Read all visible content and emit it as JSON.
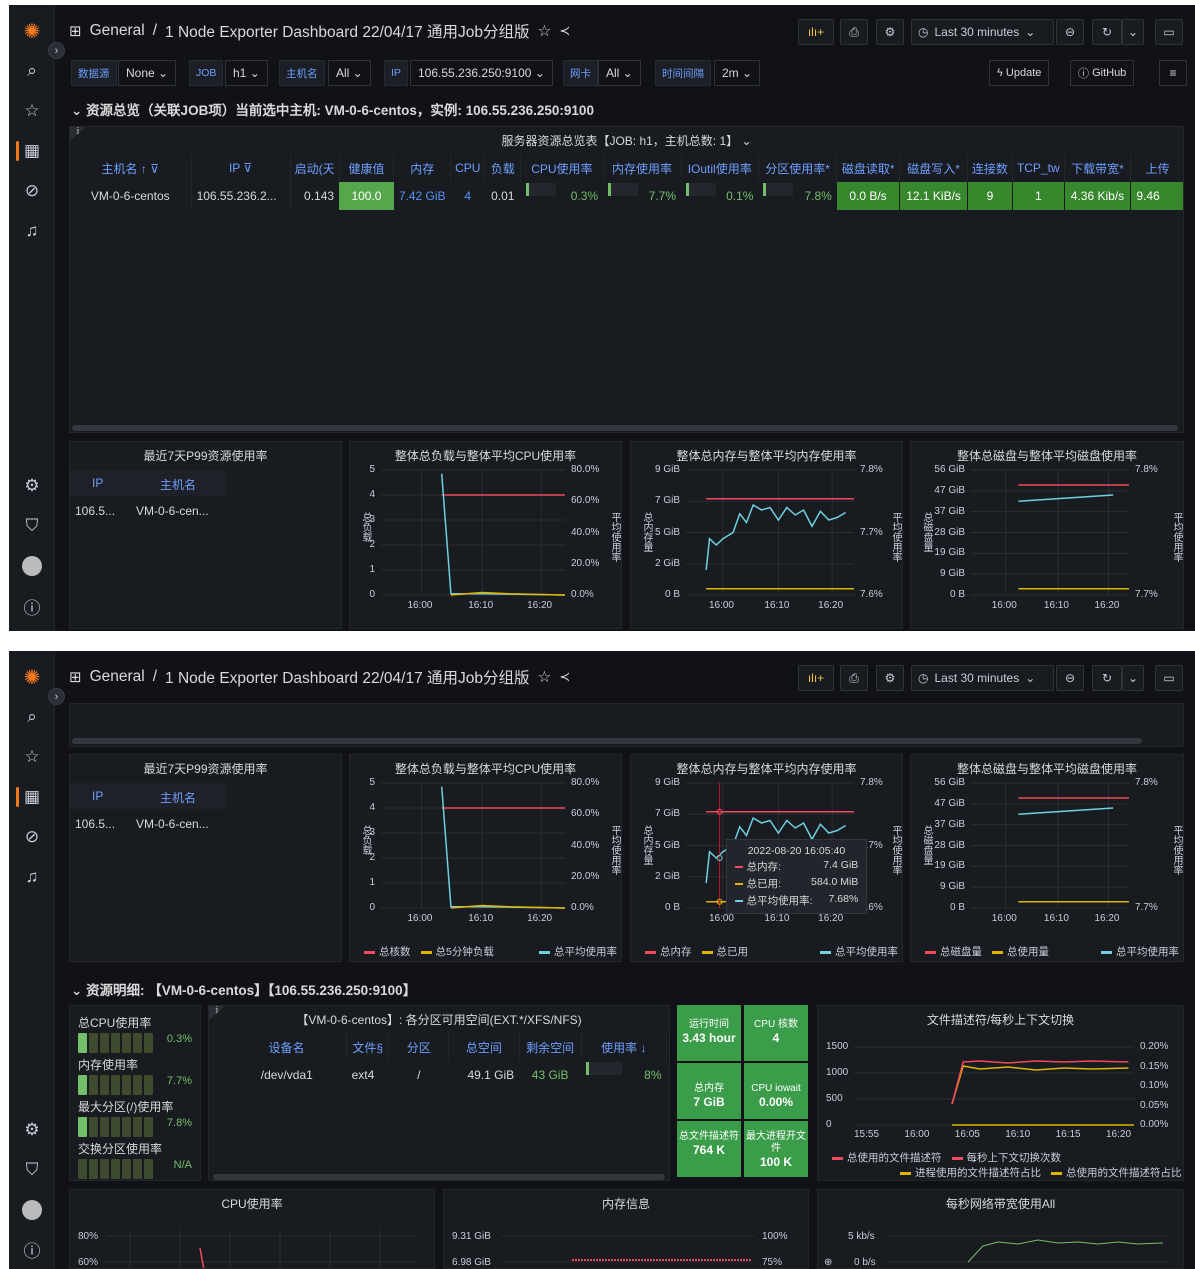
{
  "nav": {
    "home_label": "General",
    "separator": "/",
    "dashboard_title": "1 Node Exporter Dashboard 22/04/17 通用Job分组版",
    "time_range": "Last 30 minutes",
    "grid_icon": "grid-icon",
    "star_icon": "star-icon",
    "share_icon": "share-icon"
  },
  "sidebar": {
    "icons": [
      "grafana-logo-icon",
      "search-icon",
      "star-icon",
      "dashboards-icon",
      "explore-icon",
      "alerting-icon",
      "configuration-icon",
      "shield-icon",
      "user-avatar",
      "help-icon"
    ]
  },
  "variables": [
    {
      "label": "数据源",
      "value": "None"
    },
    {
      "label": "JOB",
      "value": "h1"
    },
    {
      "label": "主机名",
      "value": "All"
    },
    {
      "label": "IP",
      "value": "106.55.236.250:9100"
    },
    {
      "label": "网卡",
      "value": "All"
    },
    {
      "label": "时间间隔",
      "value": "2m"
    }
  ],
  "links": {
    "update": "Update",
    "github": "GitHub"
  },
  "overview": {
    "row_title": "资源总览（关联JOB项）当前选中主机: VM-0-6-centos，实例: 106.55.236.250:9100",
    "table_title": "服务器资源总览表【JOB: h1，主机总数: 1】",
    "columns": [
      "主机名",
      "IP",
      "启动(天",
      "健康值",
      "内存",
      "CPU",
      "负载",
      "CPU使用率",
      "内存使用率",
      "IOutil使用率",
      "分区使用率*",
      "磁盘读取*",
      "磁盘写入*",
      "连接数",
      "TCP_tw",
      "下载带宽*",
      "上传"
    ],
    "row": {
      "host": "VM-0-6-centos",
      "ip": "106.55.236.2...",
      "uptime": "0.143",
      "health": "100.0",
      "mem": "7.42 GiB",
      "cpu": "4",
      "load": "0.01",
      "cpu_pct": "0.3%",
      "mem_pct": "7.7%",
      "io_pct": "0.1%",
      "part_pct": "7.8%",
      "disk_read": "0.0 B/s",
      "disk_write": "12.1 KiB/s",
      "conn": "9",
      "tcp_tw": "1",
      "down": "4.36 Kib/s",
      "up": "9.46"
    },
    "gauges": {
      "cpu": 0.003,
      "mem": 0.077,
      "io": 0.001,
      "part": 0.078
    }
  },
  "p99": {
    "title": "最近7天P99资源使用率",
    "col_ip": "IP",
    "col_host": "主机名",
    "ip": "106.5...",
    "host": "VM-0-6-cen..."
  },
  "charts": {
    "load": {
      "title": "整体总负载与整体平均CPU使用率",
      "ylabel": "总负载",
      "y2label": "平均使用率",
      "yticks": [
        "5",
        "4",
        "3",
        "2",
        "1",
        "0"
      ],
      "y2ticks": [
        "80.0%",
        "60.0%",
        "40.0%",
        "20.0%",
        "0.0%"
      ],
      "xticks": [
        "16:00",
        "16:10",
        "16:20"
      ],
      "legend": [
        "总核数",
        "总5分钟负载",
        "总平均使用率"
      ]
    },
    "mem": {
      "title": "整体总内存与整体平均内存使用率",
      "ylabel": "总内存量",
      "y2label": "平均使用率",
      "yticks": [
        "9 GiB",
        "7 GiB",
        "5 GiB",
        "2 GiB",
        "0 B"
      ],
      "y2ticks": [
        "7.8%",
        "7.7%",
        "7.6%"
      ],
      "xticks": [
        "16:00",
        "16:10",
        "16:20"
      ],
      "legend": [
        "总内存",
        "总已用",
        "总平均使用率"
      ]
    },
    "disk": {
      "title": "整体总磁盘与整体平均磁盘使用率",
      "ylabel": "总磁盘量",
      "y2label": "平均使用率",
      "yticks": [
        "56 GiB",
        "47 GiB",
        "37 GiB",
        "28 GiB",
        "19 GiB",
        "9 GiB",
        "0 B"
      ],
      "y2ticks": [
        "7.8%",
        "7.7%"
      ],
      "xticks": [
        "16:00",
        "16:10",
        "16:20"
      ],
      "legend": [
        "总磁盘量",
        "总使用量",
        "总平均使用率"
      ]
    }
  },
  "tooltip": {
    "time": "2022-08-20 16:05:40",
    "rows": [
      {
        "k": "总内存:",
        "v": "7.4 GiB"
      },
      {
        "k": "总已用:",
        "v": "584.0 MiB"
      },
      {
        "k": "总平均使用率:",
        "v": "7.68%"
      }
    ]
  },
  "detail": {
    "row_title": "资源明细: 【VM-0-6-centos】【106.55.236.250:9100】",
    "bars": [
      {
        "label": "总CPU使用率",
        "value": "0.3%",
        "on": 1
      },
      {
        "label": "内存使用率",
        "value": "7.7%",
        "on": 1
      },
      {
        "label": "最大分区(/)使用率",
        "value": "7.8%",
        "on": 1
      },
      {
        "label": "交换分区使用率",
        "value": "N/A",
        "on": 0
      }
    ],
    "fs_title": "【VM-0-6-centos】: 各分区可用空间(EXT.*/XFS/NFS)",
    "fs_cols": [
      "设备名",
      "文件§",
      "分区",
      "总空间",
      "剩余空间",
      "使用率"
    ],
    "fs_row": {
      "dev": "/dev/vda1",
      "fs": "ext4",
      "mount": "/",
      "total": "49.1 GiB",
      "free": "43 GiB",
      "pct": "8%"
    },
    "stats": [
      {
        "label": "运行时间",
        "value": "3.43 hour"
      },
      {
        "label": "CPU 核数",
        "value": "4"
      },
      {
        "label": "总内存",
        "value": "7 GiB"
      },
      {
        "label": "CPU iowait",
        "value": "0.00%"
      },
      {
        "label": "总文件描述符",
        "value": "764 K"
      },
      {
        "label": "最大进程开文件",
        "value": "100 K"
      }
    ],
    "fd": {
      "title": "文件描述符/每秒上下文切换",
      "yticks": [
        "1500",
        "1000",
        "500",
        "0"
      ],
      "y2ticks": [
        "0.20%",
        "0.15%",
        "0.10%",
        "0.05%",
        "0.00%"
      ],
      "xticks": [
        "15:55",
        "16:00",
        "16:05",
        "16:10",
        "16:15",
        "16:20"
      ],
      "legend": [
        "总使用的文件描述符",
        "每秒上下文切换次数",
        "进程使用的文件描述符占比",
        "总使用的文件描述符占比"
      ]
    },
    "cpu_title": "CPU使用率",
    "cpu_yticks": [
      "80%",
      "60%"
    ],
    "mem_title": "内存信息",
    "mem_yticks": [
      "9.31 GiB",
      "6.98 GiB"
    ],
    "mem_y2": [
      "100%",
      "75%"
    ],
    "net_title": "每秒网络带宽使用All",
    "net_yticks": [
      "5 kb/s",
      "0 b/s"
    ]
  }
}
